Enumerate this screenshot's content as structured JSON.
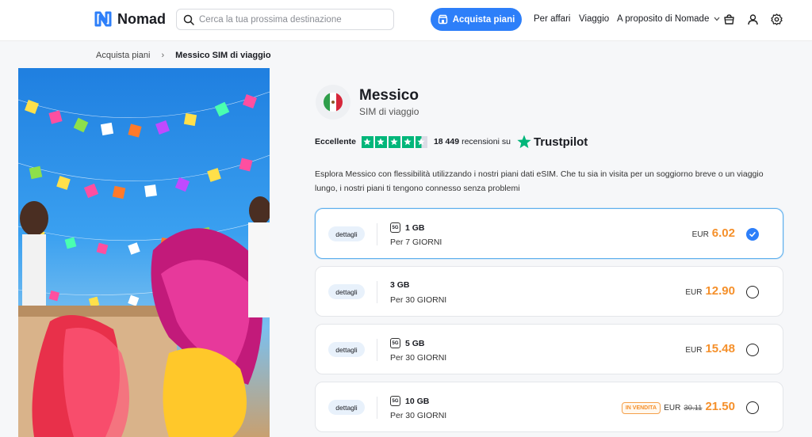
{
  "header": {
    "brand": "Nomad",
    "search_placeholder": "Cerca la tua prossima destinazione",
    "buy_button": "Acquista piani",
    "nav": [
      "Per affari",
      "Viaggio",
      "A proposito di Nomade"
    ]
  },
  "breadcrumb": {
    "parent": "Acquista piani",
    "separator": "›",
    "current": "Messico SIM di viaggio"
  },
  "product": {
    "title": "Messico",
    "subtitle": "SIM di viaggio",
    "rating_label": "Eccellente",
    "review_count": "18 449",
    "review_suffix": "recensioni su",
    "trustpilot": "Trustpilot",
    "description": "Esplora Messico con flessibilità utilizzando i nostri piani dati eSIM. Che tu sia in visita per un soggiorno breve o un viaggio lungo, i nostri piani ti tengono connesso senza problemi"
  },
  "plans": [
    {
      "details": "dettagli",
      "gb": "1 GB",
      "days": "Per 7 GIORNI",
      "currency": "EUR",
      "price": "6.02",
      "old_price": "",
      "badge": "",
      "selected": true,
      "has_5g": true
    },
    {
      "details": "dettagli",
      "gb": "3 GB",
      "days": "Per 30 GIORNI",
      "currency": "EUR",
      "price": "12.90",
      "old_price": "",
      "badge": "",
      "selected": false,
      "has_5g": false
    },
    {
      "details": "dettagli",
      "gb": "5 GB",
      "days": "Per 30 GIORNI",
      "currency": "EUR",
      "price": "15.48",
      "old_price": "",
      "badge": "",
      "selected": false,
      "has_5g": true
    },
    {
      "details": "dettagli",
      "gb": "10 GB",
      "days": "Per 30 GIORNI",
      "currency": "EUR",
      "price": "21.50",
      "old_price": "30.11",
      "badge": "IN VENDITA",
      "selected": false,
      "has_5g": true
    }
  ],
  "colors": {
    "accent": "#2d7ff9",
    "price": "#f5902b",
    "trustpilot": "#00b67a"
  }
}
